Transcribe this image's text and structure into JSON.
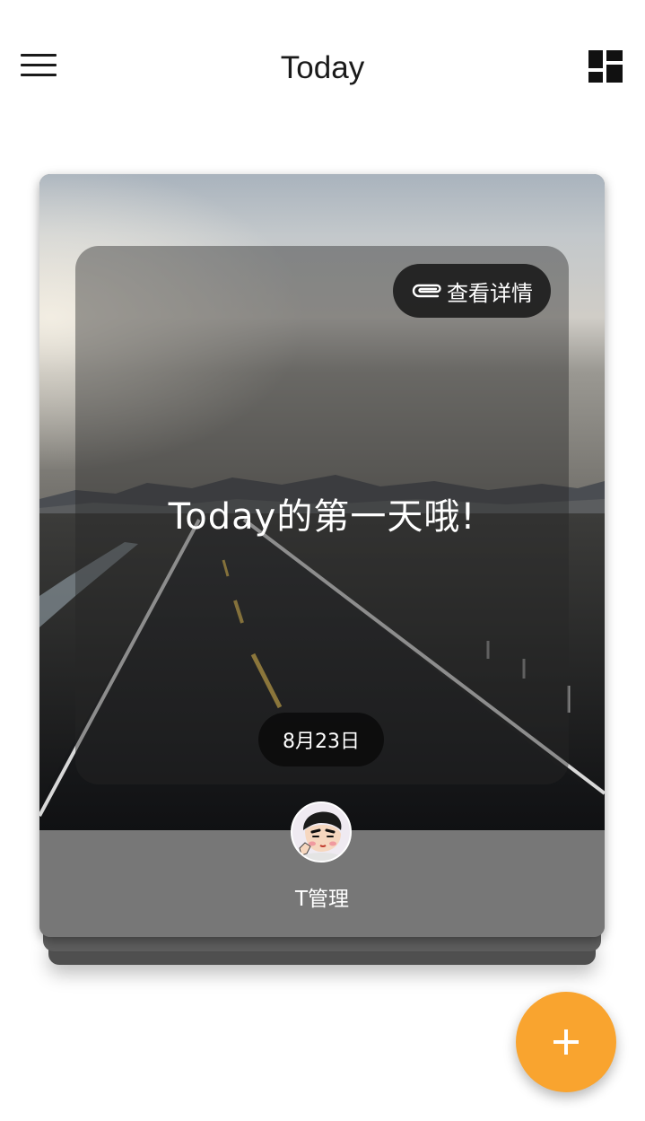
{
  "header": {
    "title": "Today",
    "menu_icon": "hamburger-menu-icon",
    "layout_icon": "dashboard-grid-icon"
  },
  "card": {
    "detail_button": {
      "icon": "paperclip-icon",
      "label": "查看详情"
    },
    "headline": "Today的第一天哦!",
    "date": "8月23日",
    "author": {
      "name": "T管理",
      "avatar": "cartoon-avatar"
    },
    "background_image": "road-landscape-photo"
  },
  "fab": {
    "icon": "plus-icon",
    "color": "#f9a42f"
  },
  "colors": {
    "accent": "#f9a42f",
    "card_footer": "#777777",
    "text_dark": "#1a1a1a"
  }
}
